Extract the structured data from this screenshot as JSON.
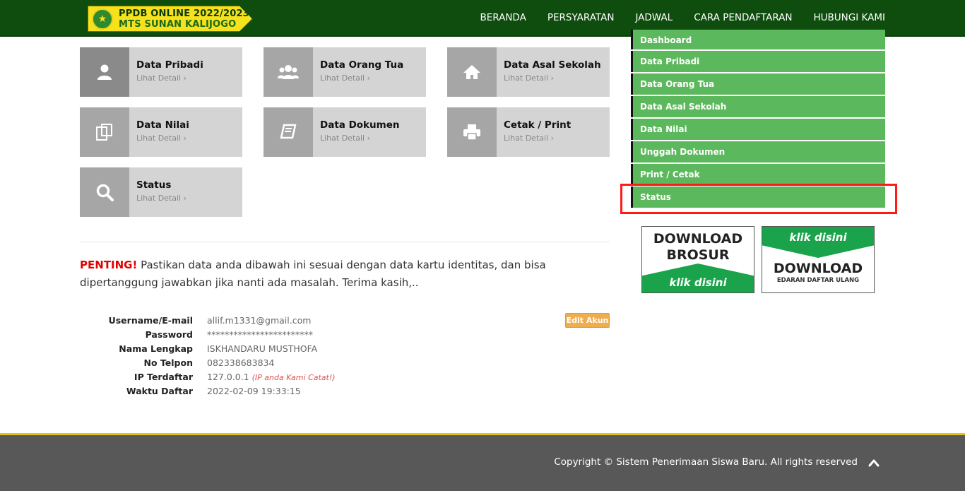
{
  "header": {
    "logo_line1": "PPDB ONLINE 2022/2023",
    "logo_line2": "MTS SUNAN KALIJOGO",
    "nav": [
      "BERANDA",
      "PERSYARATAN",
      "JADWAL",
      "CARA PENDAFTARAN",
      "HUBUNGI KAMI"
    ]
  },
  "tiles": [
    {
      "title": "Data Pribadi",
      "link": "Lihat Detail ›",
      "icon": "user-icon"
    },
    {
      "title": "Data Orang Tua",
      "link": "Lihat Detail ›",
      "icon": "users-icon"
    },
    {
      "title": "Data Asal Sekolah",
      "link": "Lihat Detail ›",
      "icon": "home-icon"
    },
    {
      "title": "Data Nilai",
      "link": "Lihat Detail ›",
      "icon": "copy-icon"
    },
    {
      "title": "Data Dokumen",
      "link": "Lihat Detail ›",
      "icon": "book-icon"
    },
    {
      "title": "Cetak / Print",
      "link": "Lihat Detail ›",
      "icon": "print-icon"
    },
    {
      "title": "Status",
      "link": "Lihat Detail ›",
      "icon": "search-icon"
    }
  ],
  "notice": {
    "penting": "PENTING!",
    "text": " Pastikan data anda dibawah ini sesuai dengan data kartu identitas, dan bisa dipertanggung jawabkan jika nanti ada masalah. Terima kasih,.."
  },
  "account": {
    "edit_label": "Edit Akun",
    "rows": [
      {
        "label": "Username/E-mail",
        "value": "allif.m1331@gmail.com"
      },
      {
        "label": "Password",
        "value": "************************"
      },
      {
        "label": "Nama Lengkap",
        "value": "ISKHANDARU MUSTHOFA"
      },
      {
        "label": "No Telpon",
        "value": "082338683834"
      },
      {
        "label": "IP Terdaftar",
        "value": "127.0.0.1",
        "note": "(IP anda Kami Catat!)"
      },
      {
        "label": "Waktu Daftar",
        "value": "2022-02-09 19:33:15"
      }
    ]
  },
  "side_menu": [
    "Dashboard",
    "Data Pribadi",
    "Data Orang Tua",
    "Data Asal Sekolah",
    "Data Nilai",
    "Unggah Dokumen",
    "Print / Cetak",
    "Status"
  ],
  "banners": {
    "b1_line1": "DOWNLOAD",
    "b1_line2": "BROSUR",
    "b1_klik": "klik disini",
    "b2_klik": "klik disini",
    "b2_download": "DOWNLOAD",
    "b2_sub": "EDARAN DAFTAR ULANG"
  },
  "footer": {
    "copyright": "Copyright © Sistem Penerimaan Siswa Baru. All rights reserved"
  },
  "colors": {
    "header": "#0f4d0f",
    "menu_green": "#5cb85c",
    "highlight": "#ff1a1a",
    "footer": "#585858",
    "penting": "#e00000"
  }
}
